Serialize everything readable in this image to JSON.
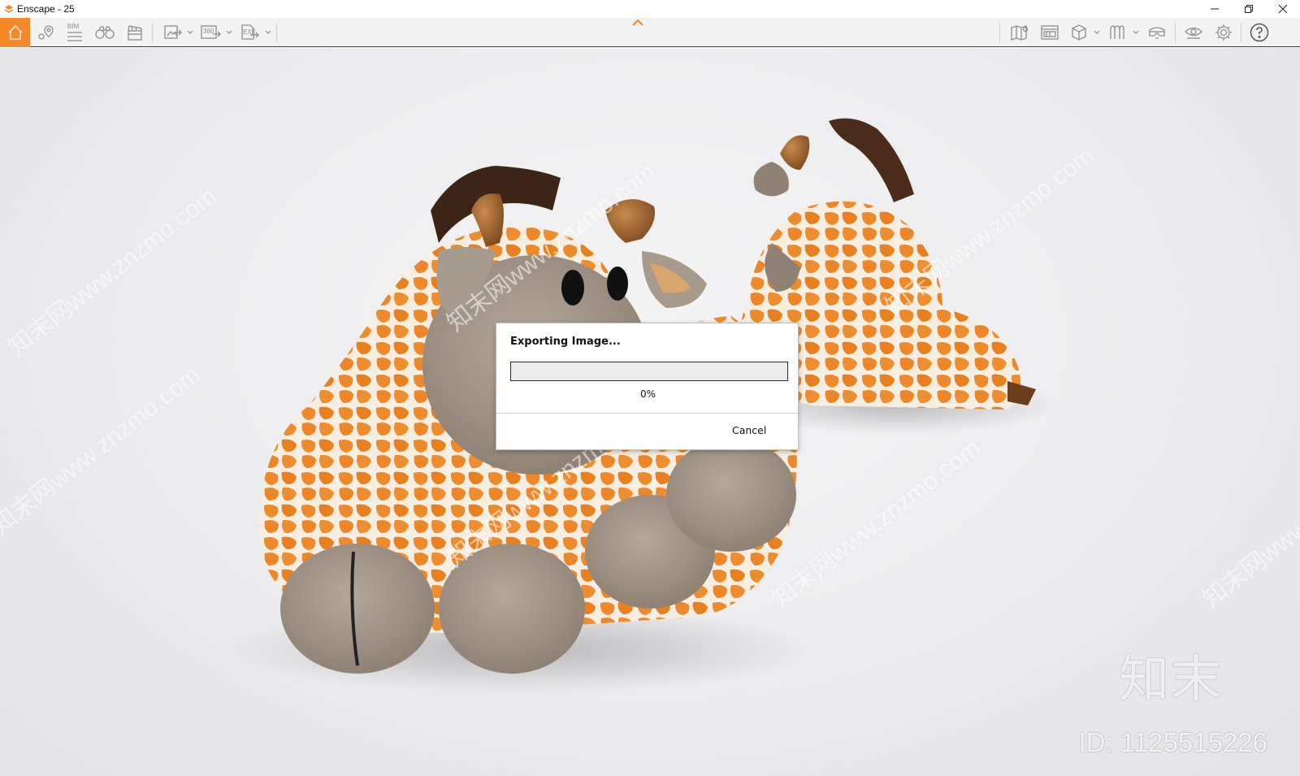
{
  "window": {
    "title": "Enscape - 25",
    "controls": [
      "minimize",
      "restore",
      "close"
    ]
  },
  "toolbar": {
    "left_icons": [
      "home-icon",
      "location-pin-icon",
      "bim-icon",
      "binoculars-icon",
      "clapperboard-icon",
      "export-image-icon",
      "export-360-icon",
      "export-exe-icon"
    ],
    "bim_label": "BIM",
    "pano_label": "360",
    "exe_label": "EXE",
    "right_icons": [
      "map-icon",
      "asset-library-icon",
      "cube-view-icon",
      "material-icon",
      "vr-headset-icon",
      "visibility-icon",
      "settings-icon",
      "help-icon"
    ],
    "accent_color": "#f5892a"
  },
  "dialog": {
    "title": "Exporting Image...",
    "progress_percent_label": "0%",
    "progress_fraction": 0,
    "cancel_label": "Cancel"
  },
  "watermark": {
    "brand": "知末",
    "id_text": "ID: 1125515226",
    "diagonal_text": "知末网www.znzmo.com"
  }
}
